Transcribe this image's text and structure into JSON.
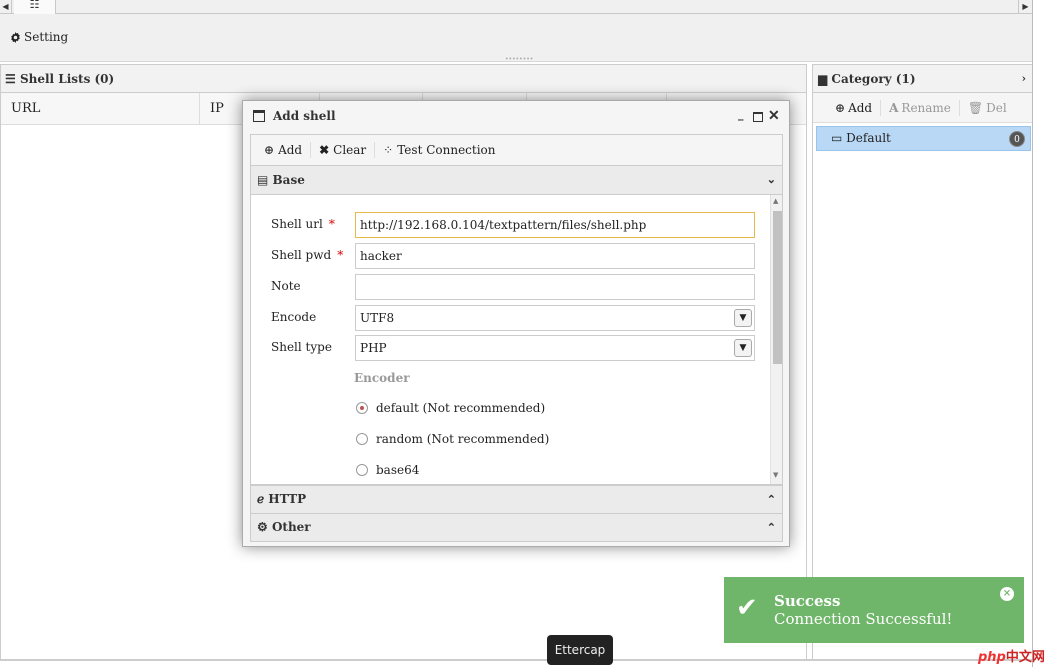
{
  "top_tabs": {
    "left_arrow": "◀",
    "grid_icon": "☷",
    "right_arrow": "▶"
  },
  "toolbar": {
    "setting_label": "Setting"
  },
  "shell_panel": {
    "title": "Shell Lists (0)",
    "columns": [
      "URL",
      "IP",
      "",
      "",
      "",
      ""
    ]
  },
  "category_panel": {
    "title": "Category (1)",
    "toggle": "›",
    "add_label": "Add",
    "rename_label": "Rename",
    "del_label": "Del",
    "items": [
      {
        "label": "Default",
        "count": "0"
      }
    ]
  },
  "modal": {
    "title": "Add shell",
    "toolbar": {
      "add_label": "Add",
      "clear_label": "Clear",
      "test_label": "Test Connection"
    },
    "base_section": "Base",
    "fields": {
      "shell_url_label": "Shell url",
      "shell_url_value": "http://192.168.0.104/textpattern/files/shell.php",
      "shell_pwd_label": "Shell pwd",
      "shell_pwd_value": "hacker",
      "note_label": "Note",
      "note_value": "",
      "encode_label": "Encode",
      "encode_value": "UTF8",
      "shell_type_label": "Shell type",
      "shell_type_value": "PHP",
      "required_mark": "*"
    },
    "encoder_label": "Encoder",
    "encoder_options": [
      {
        "label": "default (Not recommended)",
        "checked": true
      },
      {
        "label": "random (Not recommended)",
        "checked": false
      },
      {
        "label": "base64",
        "checked": false
      }
    ],
    "http_section": "HTTP",
    "other_section": "Other"
  },
  "toast": {
    "title": "Success",
    "message": "Connection Successful!",
    "check_icon": "✔",
    "close_icon": "×",
    "color": "#6fb56a"
  },
  "tooltip": {
    "text": "Ettercap"
  },
  "watermark": {
    "php": "php",
    "cn": "中文网"
  }
}
